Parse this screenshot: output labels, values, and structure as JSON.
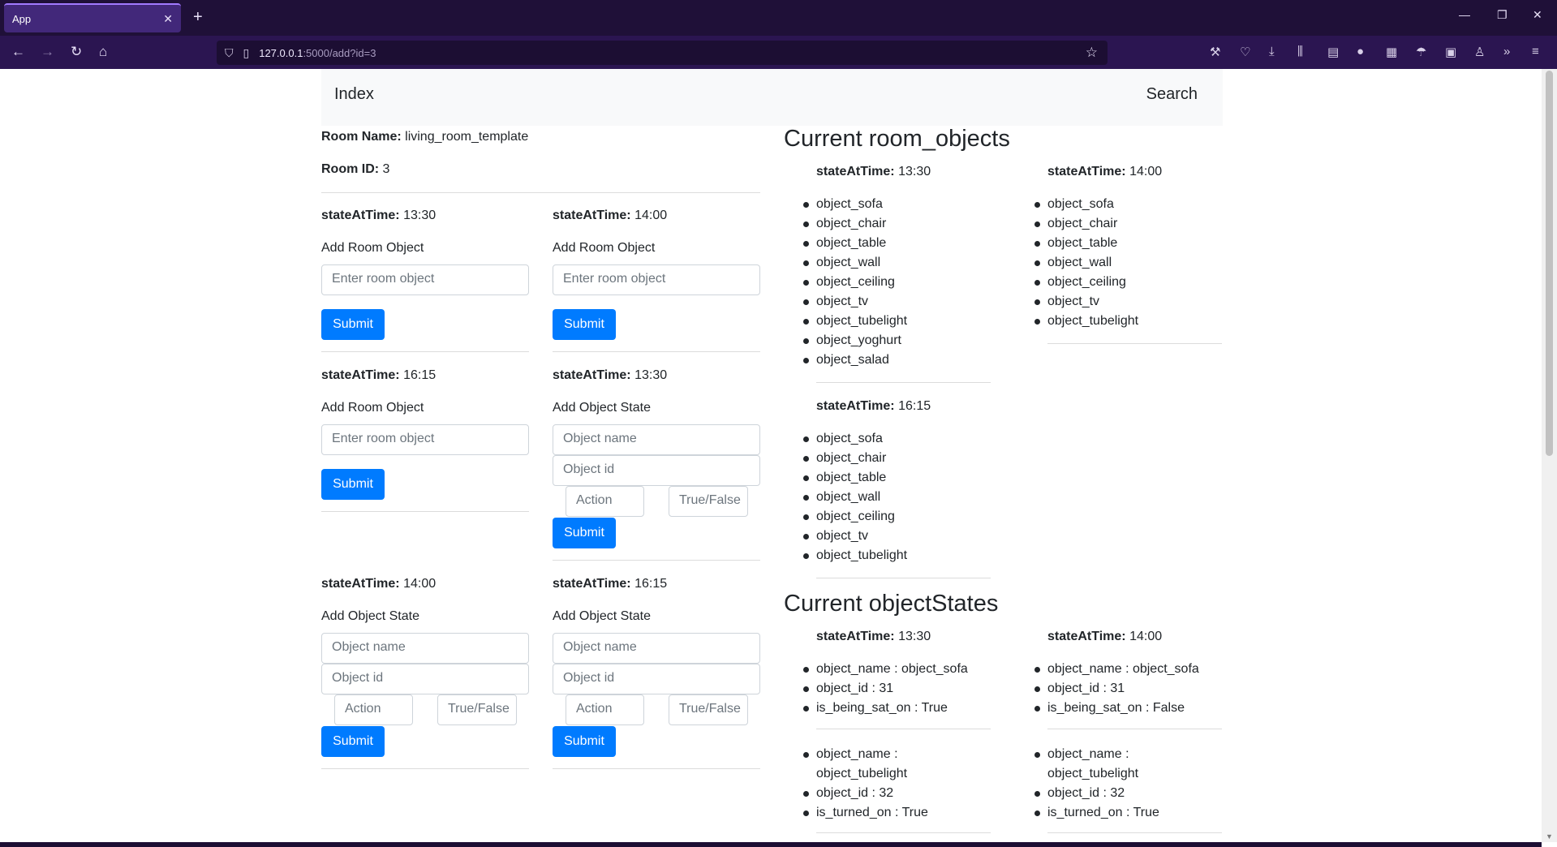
{
  "browser": {
    "tab_title": "App",
    "url_host": "127.0.0.1",
    "url_path": ":5000/add?id=3"
  },
  "nav": {
    "index": "Index",
    "search": "Search"
  },
  "room": {
    "name_label": "Room Name:",
    "name_value": " living_room_template",
    "id_label": "Room ID:",
    "id_value": " 3"
  },
  "labels": {
    "state_at_time": "stateAtTime:",
    "add_room_object": "Add Room Object",
    "add_object_state": "Add Object State",
    "submit": "Submit"
  },
  "placeholders": {
    "room_object": "Enter room object",
    "object_name": "Object name",
    "object_id": "Object id",
    "action": "Action",
    "true_false": "True/False"
  },
  "forms": [
    {
      "time": " 13:30"
    },
    {
      "time": " 14:00"
    },
    {
      "time": " 16:15"
    },
    {
      "time": " 13:30"
    },
    {
      "time": " 14:00"
    },
    {
      "time": " 16:15"
    }
  ],
  "room_objects": {
    "heading": "Current room_objects",
    "states": [
      {
        "time": " 13:30",
        "items": [
          "object_sofa",
          "object_chair",
          "object_table",
          "object_wall",
          "object_ceiling",
          "object_tv",
          "object_tubelight",
          "object_yoghurt",
          "object_salad"
        ]
      },
      {
        "time": " 14:00",
        "items": [
          "object_sofa",
          "object_chair",
          "object_table",
          "object_wall",
          "object_ceiling",
          "object_tv",
          "object_tubelight"
        ]
      },
      {
        "time": " 16:15",
        "items": [
          "object_sofa",
          "object_chair",
          "object_table",
          "object_wall",
          "object_ceiling",
          "object_tv",
          "object_tubelight"
        ]
      }
    ]
  },
  "object_states": {
    "heading": "Current objectStates",
    "states": [
      {
        "time": " 13:30",
        "groups": [
          [
            "object_name : object_sofa",
            "object_id : 31",
            "is_being_sat_on : True"
          ],
          [
            "object_name :",
            "object_tubelight",
            "object_id : 32",
            "is_turned_on : True"
          ]
        ]
      },
      {
        "time": " 14:00",
        "groups": [
          [
            "object_name : object_sofa",
            "object_id : 31",
            "is_being_sat_on : False"
          ],
          [
            "object_name :",
            "object_tubelight",
            "object_id : 32",
            "is_turned_on : True"
          ]
        ]
      }
    ]
  }
}
